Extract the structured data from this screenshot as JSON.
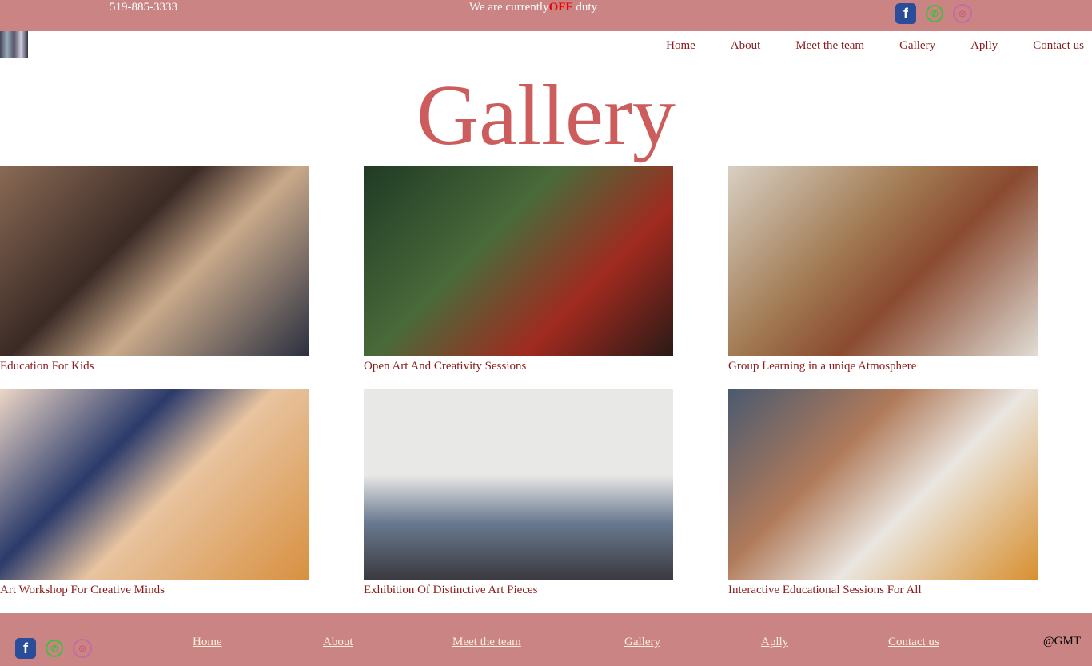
{
  "topbar": {
    "phone": "519-885-3333",
    "duty_prefix": "We are currently",
    "duty_status": "OFF",
    "duty_suffix": " duty",
    "status_color": "#ee0000"
  },
  "social": [
    "facebook-icon",
    "whatsapp-icon",
    "instagram-icon"
  ],
  "nav": [
    "Home",
    "About",
    "Meet the team",
    "Gallery",
    "Aplly",
    "Contact us"
  ],
  "page_title": "Gallery",
  "gallery": [
    {
      "caption": "Education For Kids"
    },
    {
      "caption": "Open Art And Creativity Sessions"
    },
    {
      "caption": "Group Learning in a uniqe Atmosphere"
    },
    {
      "caption": "Art Workshop For Creative Minds"
    },
    {
      "caption": "Exhibition Of Distinctive Art Pieces"
    },
    {
      "caption": "Interactive Educational Sessions For All"
    }
  ],
  "footer": {
    "nav": [
      "Home",
      "About",
      "Meet the team",
      "Gallery",
      "Aplly",
      "Contact us"
    ],
    "copyright": "@GMT"
  },
  "colors": {
    "bar": "#c98483",
    "title": "#cd5c5c",
    "nav": "#8b1a1a"
  }
}
